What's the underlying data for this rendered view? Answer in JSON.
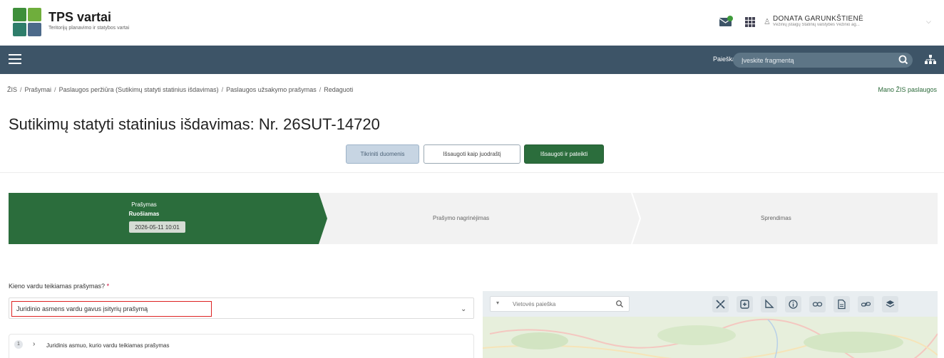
{
  "app": {
    "title": "TPS vartai",
    "subtitle": "Teritorijų planavimo ir statybos vartai"
  },
  "user": {
    "name": "DONATA GARUNKŠTIENĖ",
    "org": "Vėžinių įstaigų Statinių valstybės Vėžinio ag..."
  },
  "navbar": {
    "search_label": "Paieška",
    "search_placeholder": "Įveskite fragmentą"
  },
  "breadcrumb": {
    "items": [
      "ŽIS",
      "Prašymai",
      "Paslaugos peržiūra (Sutikimų statyti statinius išdavimas)",
      "Paslaugos užsakymo prašymas",
      "Redaguoti"
    ],
    "my_services": "Mano ŽIS paslaugos"
  },
  "page": {
    "title": "Sutikimų statyti statinius išdavimas: Nr. 26SUT-14720"
  },
  "actions": {
    "tech_data": "Tikriniti duomenis",
    "save_draft": "Išsaugoti kaip juodraštį",
    "save_submit": "Išsaugoti ir pateikti"
  },
  "stepper": {
    "steps": [
      {
        "title": "Prašymas",
        "status": "Ruošiamas",
        "date": "2026-05-11 10:01"
      },
      {
        "title": "Prašymo nagrinėjimas"
      },
      {
        "title": "Sprendimas"
      }
    ]
  },
  "form": {
    "question": "Kieno vardu teikiamas prašymas?",
    "required_mark": "*",
    "selected_value": "Juridinio asmens vardu gavus įsityrių prašymą",
    "section_number": "1",
    "section_title": "Juridinis asmuo, kurio vardu teikiamas prašymas"
  },
  "map": {
    "search_placeholder": "Vietovės paieška"
  },
  "colors": {
    "navbar": "#3d5467",
    "primary_green": "#2b6d3c",
    "highlight_red": "#dd2222"
  }
}
